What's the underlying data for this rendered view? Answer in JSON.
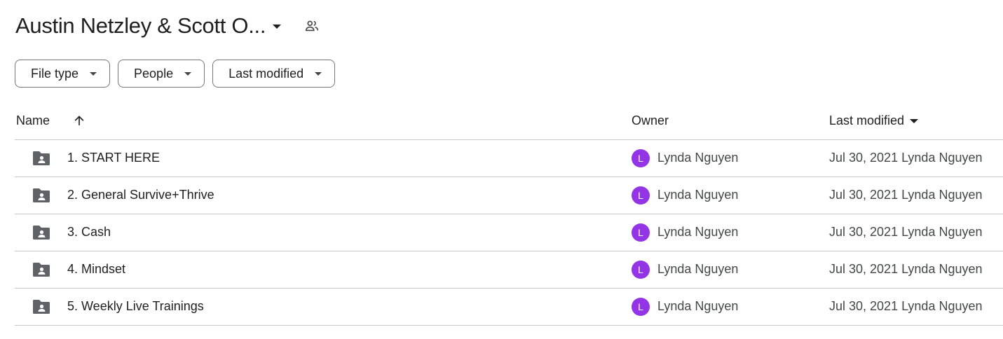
{
  "header": {
    "folder_title": "Austin Netzley & Scott O...",
    "dropdown_icon": "arrow-drop-down-icon",
    "shared_icon": "people-icon"
  },
  "filters": [
    {
      "label": "File type",
      "icon": "arrow-drop-down-icon"
    },
    {
      "label": "People",
      "icon": "arrow-drop-down-icon"
    },
    {
      "label": "Last modified",
      "icon": "arrow-drop-down-icon"
    }
  ],
  "table": {
    "columns": {
      "name": "Name",
      "owner": "Owner",
      "last_modified": "Last modified"
    },
    "sort_icon": "arrow-upward-icon",
    "rows": [
      {
        "name": "1. START HERE",
        "owner_initial": "L",
        "owner": "Lynda Nguyen",
        "modified": "Jul 30, 2021 Lynda Nguyen"
      },
      {
        "name": "2. General Survive+Thrive",
        "owner_initial": "L",
        "owner": "Lynda Nguyen",
        "modified": "Jul 30, 2021 Lynda Nguyen"
      },
      {
        "name": "3. Cash",
        "owner_initial": "L",
        "owner": "Lynda Nguyen",
        "modified": "Jul 30, 2021 Lynda Nguyen"
      },
      {
        "name": "4. Mindset",
        "owner_initial": "L",
        "owner": "Lynda Nguyen",
        "modified": "Jul 30, 2021 Lynda Nguyen"
      },
      {
        "name": "5. Weekly Live Trainings",
        "owner_initial": "L",
        "owner": "Lynda Nguyen",
        "modified": "Jul 30, 2021 Lynda Nguyen"
      }
    ]
  },
  "colors": {
    "avatar": "#9334e6",
    "folder_icon": "#5f6368",
    "divider": "#c7c7c7"
  }
}
